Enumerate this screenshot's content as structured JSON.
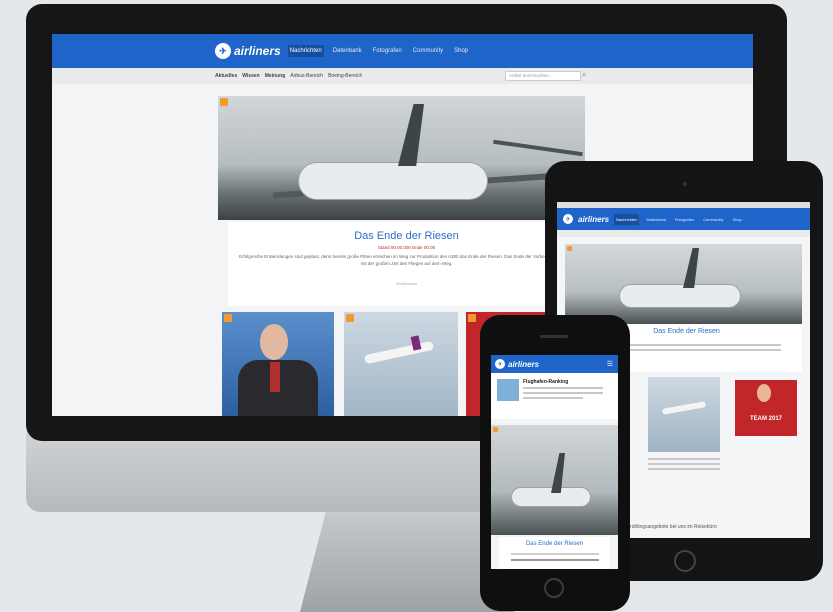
{
  "monitor": {
    "logo": "airliners",
    "nav": [
      "Nachrichten",
      "Datenbank",
      "Fotografen",
      "Community",
      "Shop"
    ],
    "subnav": [
      "Aktuelles",
      "Wissen",
      "Meinung",
      "Airbus-Bereich",
      "Boeing-Bereich"
    ],
    "search_placeholder": "Artikel durchsuchen...",
    "featured": {
      "title": "Das Ende der Riesen",
      "meta": "Stand 00.00.000 Ende 00.00",
      "body": "Erfolgreiche Entwicklungen sind geplant, denn bereits große Pläne erreichen im Weg zur Produktion des A380 das Ende der Riesen. Das Ende der Vorbereitungen wirkt mit der großen Zeit des Fliegen auf dem Weg.",
      "more": "Weiterlesen"
    }
  },
  "tablet": {
    "logo": "airliners",
    "nav": [
      "Nachrichten",
      "Datenbank",
      "Fotografen",
      "Community",
      "Shop"
    ],
    "featured_title": "Das Ende der Riesen",
    "promo_text": "TEAM 2017",
    "footer_text": "Frühlingsangebote bei uns im Reisebüro"
  },
  "phone": {
    "logo": "airliners",
    "headline": "Flughafen-Ranking",
    "featured_title": "Das Ende der Riesen"
  }
}
